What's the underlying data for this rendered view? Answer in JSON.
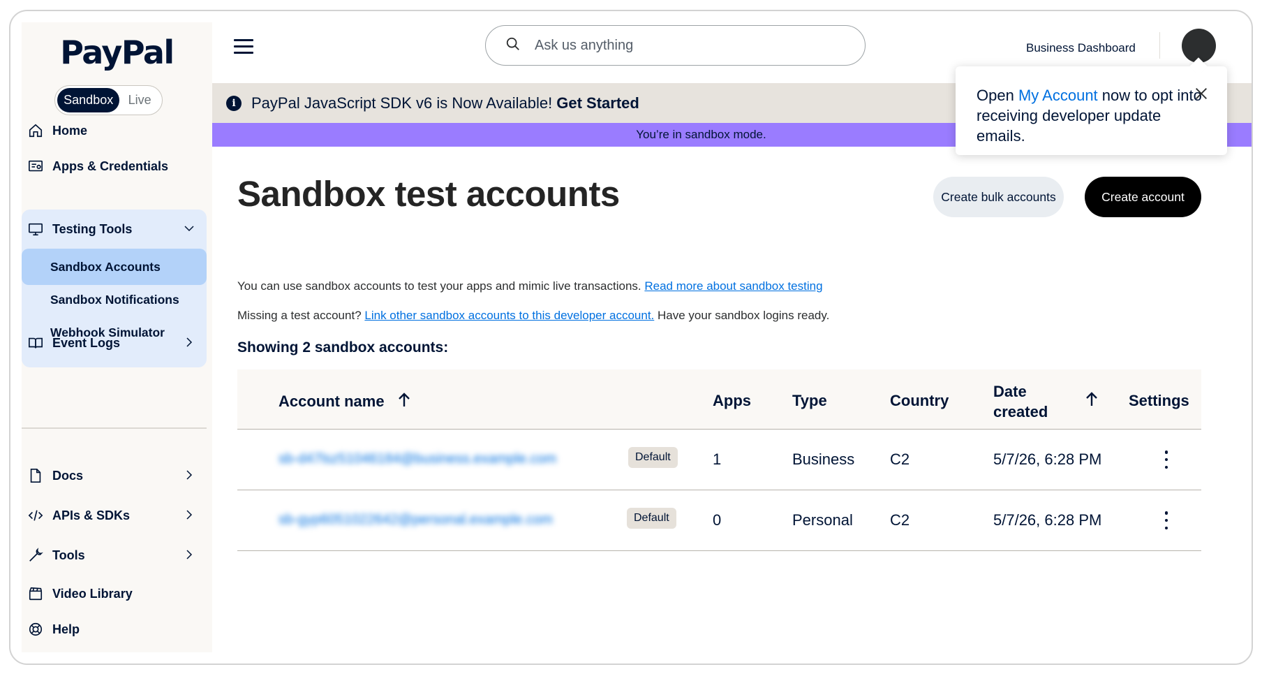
{
  "brand": {
    "logo_text": "PayPal"
  },
  "environment": {
    "options": [
      "Sandbox",
      "Live"
    ],
    "selected": "Sandbox"
  },
  "sidebar": {
    "items": [
      {
        "label": "Home",
        "icon": "home-icon"
      },
      {
        "label": "Apps & Credentials",
        "icon": "apps-icon"
      },
      {
        "label": "Testing Tools",
        "icon": "monitor-icon",
        "expanded": true,
        "children": [
          {
            "label": "Sandbox Accounts",
            "active": true
          },
          {
            "label": "Sandbox Notifications"
          },
          {
            "label": "Webhook Simulator"
          }
        ]
      },
      {
        "label": "Event Logs",
        "icon": "book-icon"
      },
      {
        "label": "Docs",
        "icon": "document-icon"
      },
      {
        "label": "APIs & SDKs",
        "icon": "code-icon"
      },
      {
        "label": "Tools",
        "icon": "wrench-icon"
      },
      {
        "label": "Video Library",
        "icon": "video-icon"
      },
      {
        "label": "Help",
        "icon": "lifebuoy-icon"
      }
    ]
  },
  "header": {
    "search_placeholder": "Ask us anything",
    "business_dashboard": "Business Dashboard"
  },
  "banners": {
    "info_text": "PayPal JavaScript SDK v6 is Now Available!",
    "info_cta": "Get Started",
    "sandbox_mode": "You’re in sandbox mode."
  },
  "popover": {
    "prefix": "Open",
    "link": "My Account",
    "suffix": "now to opt into receiving developer update emails."
  },
  "main": {
    "title": "Sandbox test accounts",
    "btn_bulk": "Create bulk accounts",
    "btn_create": "Create account",
    "intro_text": "You can use sandbox accounts to test your apps and mimic live transactions.",
    "intro_link": "Read more about sandbox testing",
    "missing_text": "Missing a test account?",
    "missing_link": "Link other sandbox accounts to this developer account.",
    "missing_suffix": "Have your sandbox logins ready.",
    "showing": "Showing 2 sandbox accounts:"
  },
  "table": {
    "columns": [
      "Account name",
      "Apps",
      "Type",
      "Country",
      "Date created",
      "Settings"
    ],
    "rows": [
      {
        "account": "sb-d47lsz51046184@business.example.com",
        "badge": "Default",
        "apps": "1",
        "type": "Business",
        "country": "C2",
        "date": "5/7/26, 6:28 PM"
      },
      {
        "account": "sb-gyp6051022642@personal.example.com",
        "badge": "Default",
        "apps": "0",
        "type": "Personal",
        "country": "C2",
        "date": "5/7/26, 6:28 PM"
      }
    ]
  },
  "colors": {
    "brand_navy": "#001435",
    "link_blue": "#0070e0",
    "sandbox_purple": "#9a7cff",
    "active_nav": "#b3d2f9"
  }
}
